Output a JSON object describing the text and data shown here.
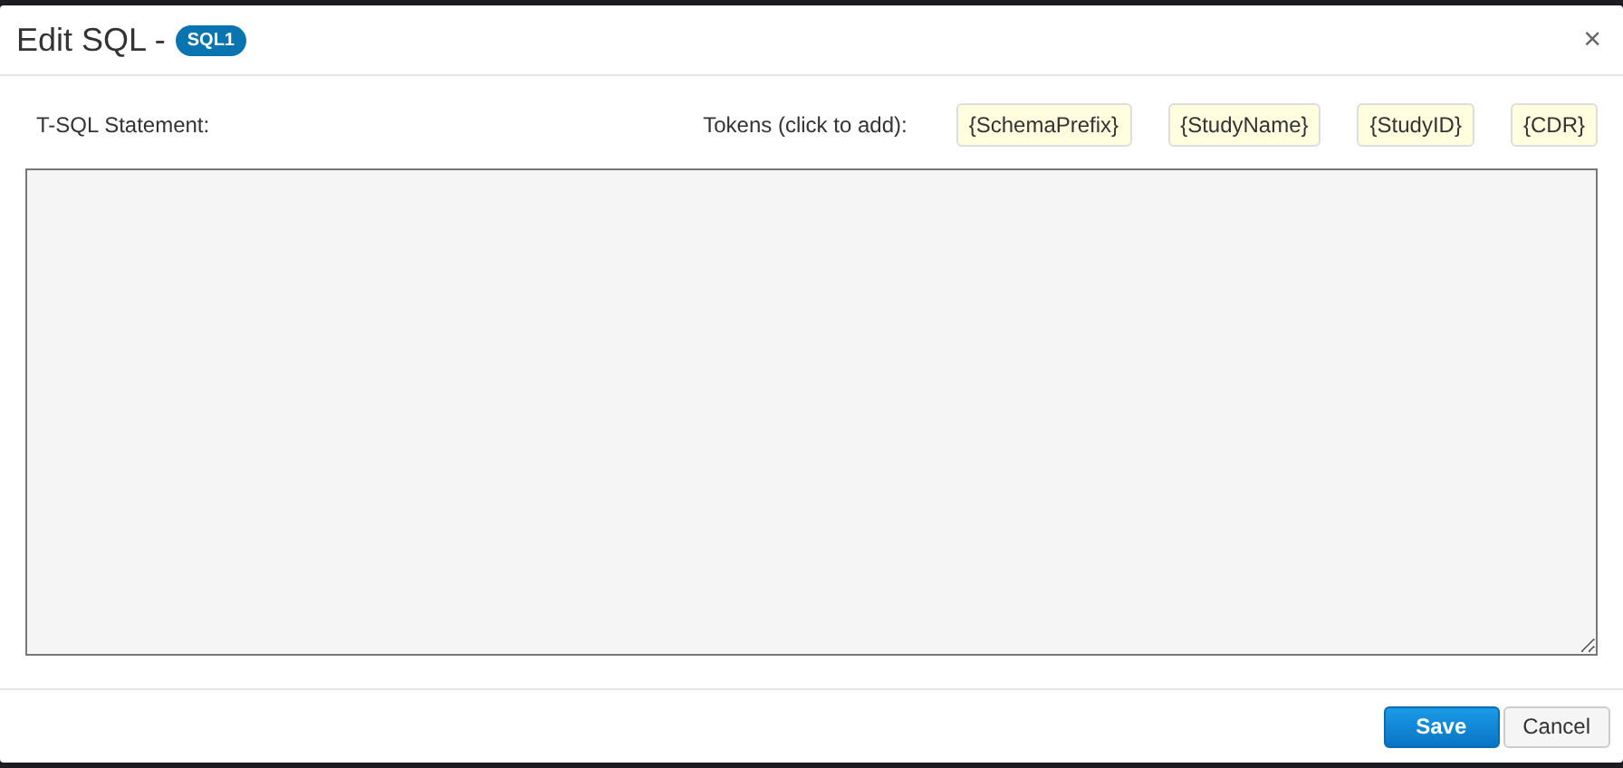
{
  "dialog": {
    "title": "Edit SQL -",
    "badge": "SQL1",
    "close": "×"
  },
  "statement_label": "T-SQL Statement:",
  "tokens_label": "Tokens (click to add):",
  "tokens": [
    "{SchemaPrefix}",
    "{StudyName}",
    "{StudyID}",
    "{CDR}"
  ],
  "buttons": [
    {
      "label": "Save",
      "kind": "primary"
    },
    {
      "label": "Cancel",
      "kind": "default"
    }
  ]
}
